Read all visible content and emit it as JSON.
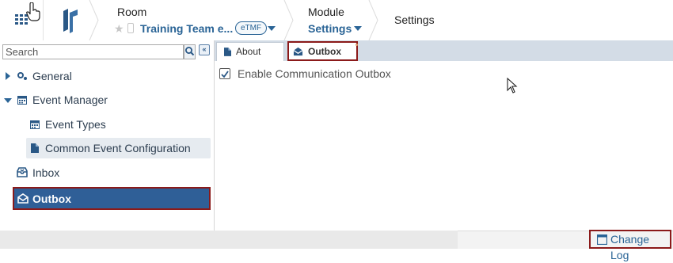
{
  "header": {
    "room_label": "Room",
    "room_value": "Training Team e...",
    "room_badge": "eTMF",
    "module_label": "Module",
    "module_value": "Settings",
    "settings_label": "Settings"
  },
  "sidebar": {
    "search_placeholder": "Search",
    "items": [
      {
        "label": "General",
        "icon": "gears-icon"
      },
      {
        "label": "Event Manager",
        "icon": "calendar-icon"
      },
      {
        "label": "Event Types",
        "icon": "calendar-icon"
      },
      {
        "label": "Common Event Configuration",
        "icon": "document-icon"
      },
      {
        "label": "Inbox",
        "icon": "inbox-icon"
      },
      {
        "label": "Outbox",
        "icon": "outbox-icon"
      }
    ]
  },
  "tabs": [
    {
      "label": "About",
      "icon": "document-icon"
    },
    {
      "label": "Outbox",
      "icon": "outbox-icon"
    }
  ],
  "content": {
    "checkbox_label": "Enable Communication Outbox",
    "checkbox_checked": true
  },
  "footer": {
    "change_log_label": "Change Log"
  },
  "colors": {
    "accent": "#2a6496",
    "selected": "#2f5f97",
    "highlight_border": "#8b1a1a"
  }
}
